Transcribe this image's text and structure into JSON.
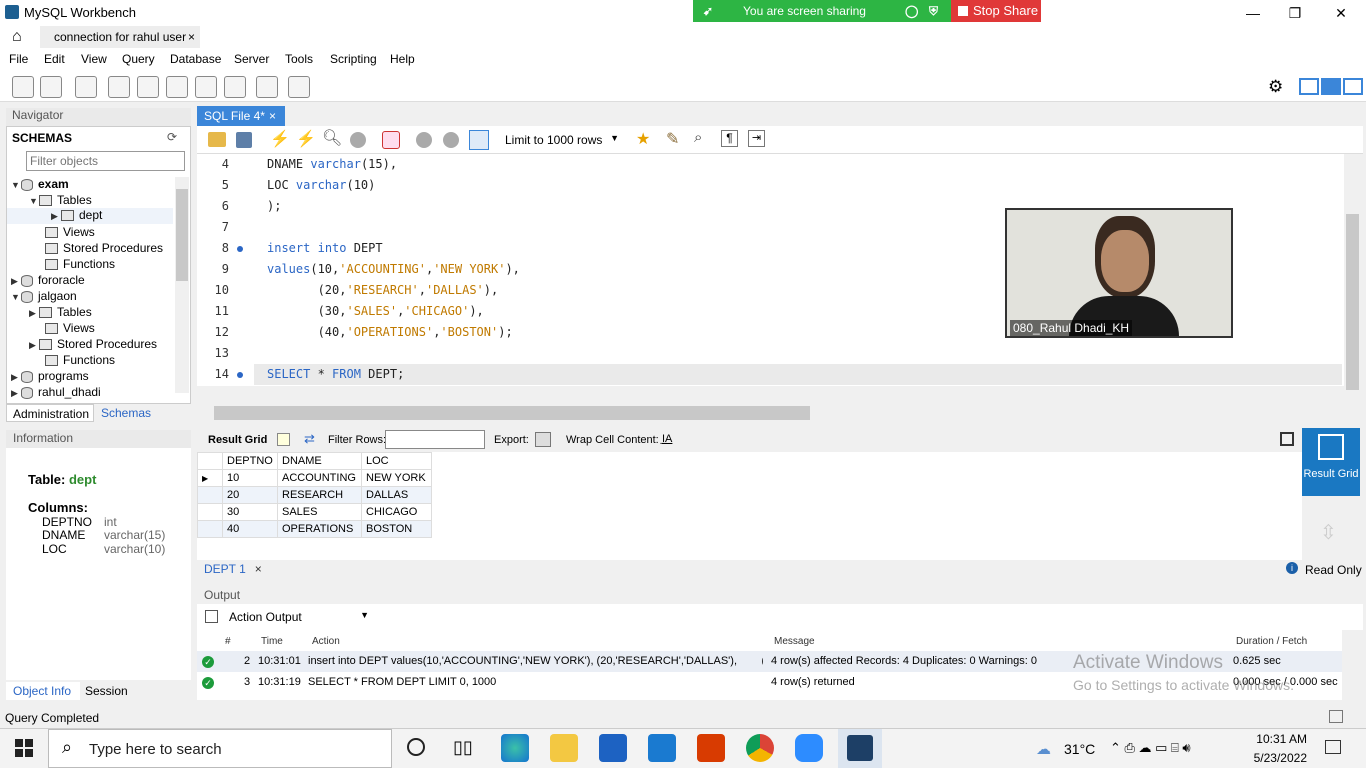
{
  "window": {
    "title": "MySQL Workbench",
    "tab": "connection for rahul user"
  },
  "sharing": {
    "label": "You are screen sharing",
    "stop": "Stop Share"
  },
  "menu": [
    "File",
    "Edit",
    "View",
    "Query",
    "Database",
    "Server",
    "Tools",
    "Scripting",
    "Help"
  ],
  "navigator": {
    "title": "Navigator",
    "schemas": "SCHEMAS",
    "filter_placeholder": "Filter objects",
    "tree": [
      "exam",
      "Tables",
      "dept",
      "Views",
      "Stored Procedures",
      "Functions",
      "fororacle",
      "jalgaon",
      "Tables",
      "Views",
      "Stored Procedures",
      "Functions",
      "programs",
      "rahul_dhadi"
    ],
    "tabs": [
      "Administration",
      "Schemas"
    ]
  },
  "information": {
    "title": "Information",
    "table_label": "Table:",
    "table_name": "dept",
    "columns_label": "Columns:",
    "columns": [
      {
        "name": "DEPTNO",
        "type": "int"
      },
      {
        "name": "DNAME",
        "type": "varchar(15)"
      },
      {
        "name": "LOC",
        "type": "varchar(10)"
      }
    ],
    "tabs": [
      "Object Info",
      "Session"
    ]
  },
  "editor": {
    "tab": "SQL File 4*",
    "limit": "Limit to 1000 rows",
    "lines": [
      {
        "n": "4",
        "text": "DNAME varchar(15),"
      },
      {
        "n": "5",
        "text": "LOC varchar(10)"
      },
      {
        "n": "6",
        "text": ");"
      },
      {
        "n": "7",
        "text": ""
      },
      {
        "n": "8",
        "text": "insert into DEPT"
      },
      {
        "n": "9",
        "text": "values(10,'ACCOUNTING','NEW YORK'),"
      },
      {
        "n": "10",
        "text": "       (20,'RESEARCH','DALLAS'),"
      },
      {
        "n": "11",
        "text": "       (30,'SALES','CHICAGO'),"
      },
      {
        "n": "12",
        "text": "       (40,'OPERATIONS','BOSTON');"
      },
      {
        "n": "13",
        "text": ""
      },
      {
        "n": "14",
        "text": "SELECT * FROM DEPT;"
      }
    ]
  },
  "video": {
    "name": "080_Rahul Dhadi_KH"
  },
  "result": {
    "label": "Result Grid",
    "filter": "Filter Rows:",
    "export": "Export:",
    "wrap": "Wrap Cell Content:",
    "side": "Result Grid",
    "headers": [
      "DEPTNO",
      "DNAME",
      "LOC"
    ],
    "rows": [
      [
        "10",
        "ACCOUNTING",
        "NEW YORK"
      ],
      [
        "20",
        "RESEARCH",
        "DALLAS"
      ],
      [
        "30",
        "SALES",
        "CHICAGO"
      ],
      [
        "40",
        "OPERATIONS",
        "BOSTON"
      ]
    ],
    "tab": "DEPT 1",
    "readonly": "Read Only"
  },
  "output": {
    "title": "Output",
    "selector": "Action Output",
    "headers": [
      "#",
      "Time",
      "Action",
      "Message",
      "Duration / Fetch"
    ],
    "rows": [
      {
        "num": "2",
        "time": "10:31:01",
        "action": "insert into DEPT values(10,'ACCOUNTING','NEW YORK'), (20,'RESEARCH','DALLAS'),        (...",
        "message": "4 row(s) affected Records: 4  Duplicates: 0  Warnings: 0",
        "duration": "0.625 sec"
      },
      {
        "num": "3",
        "time": "10:31:19",
        "action": "SELECT * FROM DEPT LIMIT 0, 1000",
        "message": "4 row(s) returned",
        "duration": "0.000 sec / 0.000 sec"
      }
    ]
  },
  "activate": {
    "line1": "Activate Windows",
    "line2": "Go to Settings to activate Windows."
  },
  "status": "Query Completed",
  "taskbar": {
    "search": "Type here to search",
    "temp": "31°C",
    "time": "10:31 AM",
    "date": "5/23/2022"
  }
}
